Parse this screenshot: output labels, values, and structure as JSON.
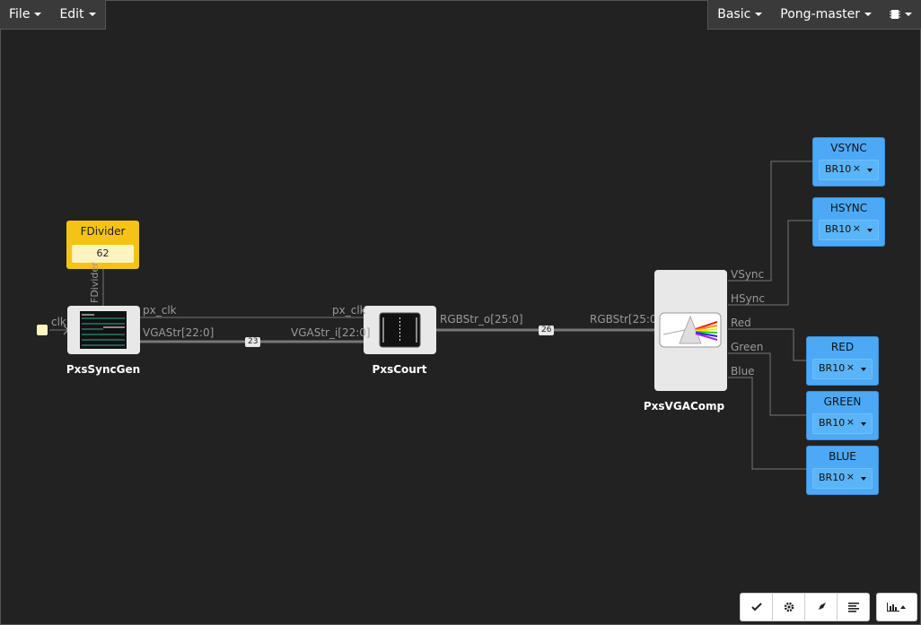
{
  "menubar": {
    "file": "File",
    "edit": "Edit",
    "mode": "Basic",
    "project": "Pong-master"
  },
  "clock_input": "clk",
  "fdivider": {
    "title": "FDivider",
    "value": "62",
    "wire_label": "FDivider"
  },
  "blocks": {
    "syncgen": "PxsSyncGen",
    "court": "PxsCourt",
    "vgacomp": "PxsVGAComp"
  },
  "signals": {
    "syncgen_out_clk": "px_clk",
    "syncgen_out_vga": "VGAStr[22:0]",
    "court_in_clk": "px_clk",
    "court_in_vga": "VGAStr_i[22:0]",
    "court_out_rgb": "RGBStr_o[25:0]",
    "vga_in_rgb": "RGBStr[25:0]",
    "vga_out_vsync": "VSync",
    "vga_out_hsync": "HSync",
    "vga_out_red": "Red",
    "vga_out_green": "Green",
    "vga_out_blue": "Blue"
  },
  "bus_widths": {
    "vga": "23",
    "rgb": "26"
  },
  "outputs": [
    {
      "title": "VSYNC",
      "pin": "BR10",
      "clear": "×"
    },
    {
      "title": "HSYNC",
      "pin": "BR10",
      "clear": "×"
    },
    {
      "title": "RED",
      "pin": "BR10",
      "clear": "×"
    },
    {
      "title": "GREEN",
      "pin": "BR10",
      "clear": "×"
    },
    {
      "title": "BLUE",
      "pin": "BR10",
      "clear": "×"
    }
  ],
  "toolbar": {
    "icons": [
      "check-icon",
      "gear-icon",
      "rocket-icon",
      "align-left-icon",
      "bar-chart-icon"
    ]
  },
  "colors": {
    "background": "#222222",
    "port_blue": "#4da9f5",
    "fdivider_yellow": "#f5c316",
    "clk_input": "#fff4c0"
  }
}
